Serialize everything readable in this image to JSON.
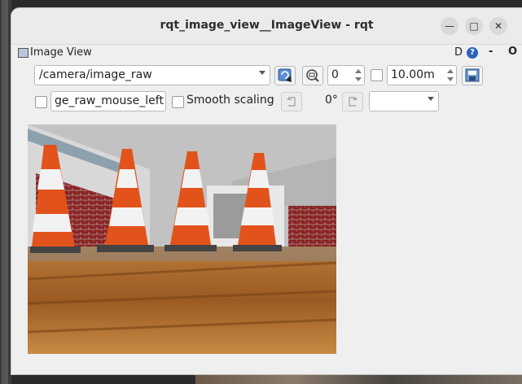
{
  "window": {
    "title": "rqt_image_view__ImageView - rqt",
    "minimize_glyph": "—",
    "maximize_glyph": "□",
    "close_glyph": "✕"
  },
  "dock": {
    "title": "Image View",
    "d_label": "D",
    "help_glyph": "?",
    "dash_glyph": "-",
    "close_glyph": "O"
  },
  "toolbar": {
    "topic": "/camera/image_raw",
    "frame_value": "0",
    "rate_value": "10.00m",
    "mouse_topic": "ge_raw_mouse_left",
    "smooth_label": "Smooth scaling",
    "rotation": "0°",
    "color_scheme": ""
  },
  "colors": {
    "cone_orange": "#e2531c",
    "cone_white": "#f2f2f2",
    "floor_wood": "#a5652a",
    "wall_brick": "#8a2424",
    "sky_gray": "#c2c2c2"
  },
  "icons": {
    "refresh": "refresh-icon",
    "zoom": "zoom-icon",
    "save": "save-icon",
    "rotate_left": "rotate-left-icon",
    "rotate_right": "rotate-right-icon"
  }
}
